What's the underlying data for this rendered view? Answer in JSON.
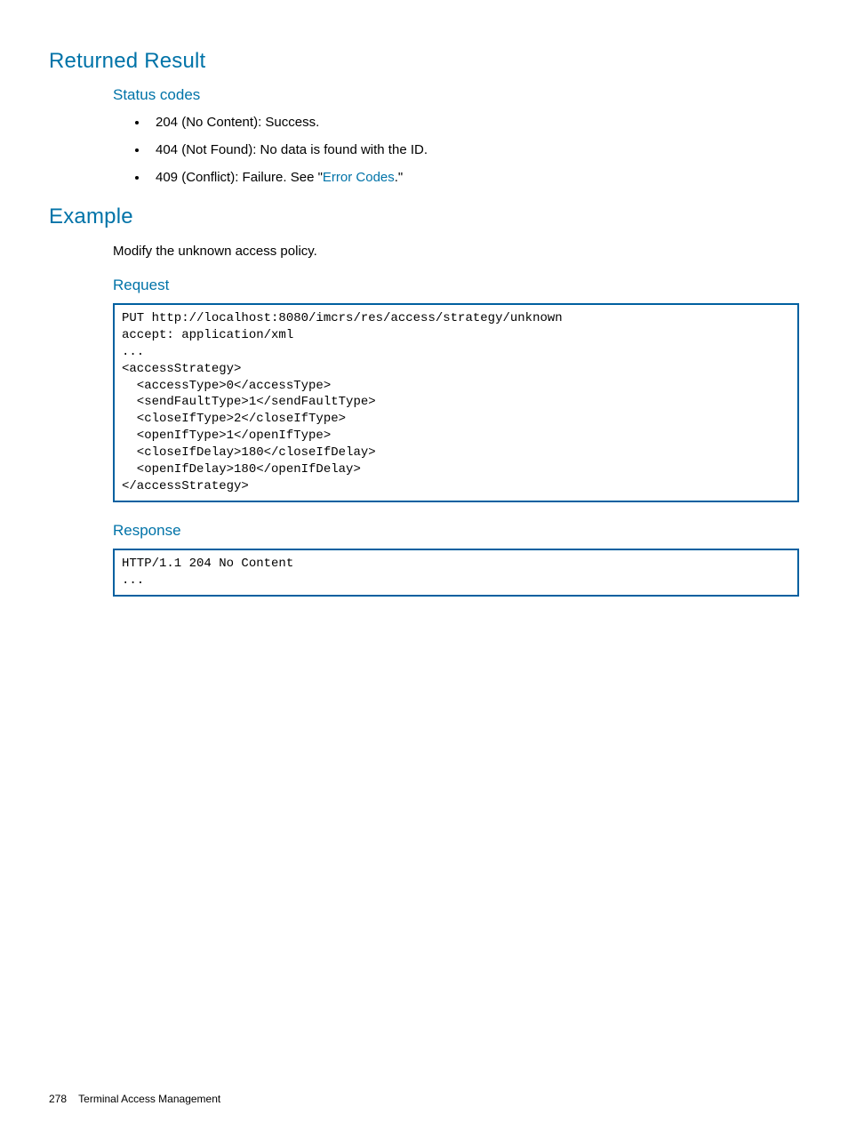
{
  "sections": {
    "returned_result": {
      "title": "Returned Result",
      "status_codes_heading": "Status codes",
      "codes": {
        "code_204": "204 (No Content): Success.",
        "code_404": "404 (Not Found): No data is found with the ID.",
        "code_409_prefix": "409 (Conflict): Failure. See \"",
        "code_409_link": "Error Codes",
        "code_409_suffix": ".\""
      }
    },
    "example": {
      "title": "Example",
      "intro": "Modify the unknown access policy.",
      "request_heading": "Request",
      "request_code": "PUT http://localhost:8080/imcrs/res/access/strategy/unknown\naccept: application/xml\n...\n<accessStrategy>\n  <accessType>0</accessType>\n  <sendFaultType>1</sendFaultType>\n  <closeIfType>2</closeIfType>\n  <openIfType>1</openIfType>\n  <closeIfDelay>180</closeIfDelay>\n  <openIfDelay>180</openIfDelay>\n</accessStrategy>",
      "response_heading": "Response",
      "response_code": "HTTP/1.1 204 No Content\n..."
    }
  },
  "footer": {
    "page_number": "278",
    "chapter": "Terminal Access Management"
  }
}
